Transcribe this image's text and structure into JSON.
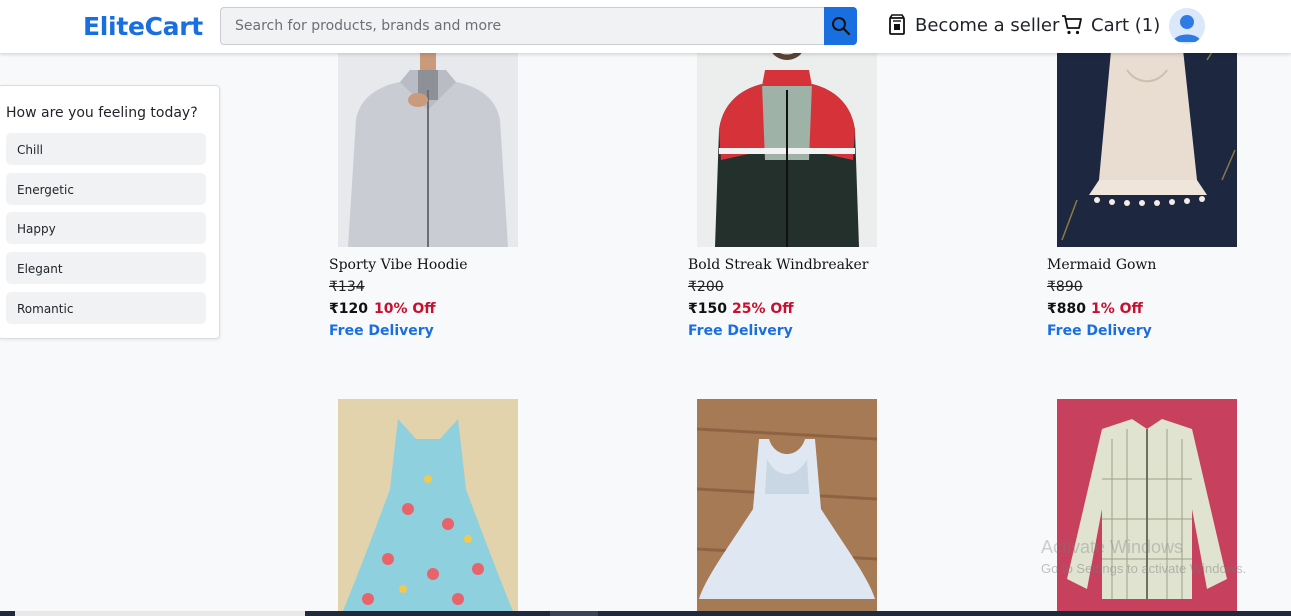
{
  "header": {
    "logo": "EliteCart",
    "search_placeholder": "Search for products, brands and more",
    "seller_label": "Become a seller",
    "cart_label": "Cart (1)",
    "icons": [
      "search-icon",
      "store-icon",
      "cart-icon",
      "user-avatar-icon"
    ],
    "accent": "#1a6fe0"
  },
  "mood": {
    "title": "How are you feeling today?",
    "options": [
      "Chill",
      "Energetic",
      "Happy",
      "Elegant",
      "Romantic"
    ]
  },
  "products": [
    {
      "name": "Sporty Vibe Hoodie",
      "mrp": "₹134",
      "price": "₹120",
      "off": "10% Off",
      "delivery": "Free Delivery"
    },
    {
      "name": "Bold Streak Windbreaker",
      "mrp": "₹200",
      "price": "₹150",
      "off": "25% Off",
      "delivery": "Free Delivery"
    },
    {
      "name": "Mermaid Gown",
      "mrp": "₹890",
      "price": "₹880",
      "off": "1% Off",
      "delivery": "Free Delivery"
    }
  ],
  "watermark": {
    "line1": "Activate Windows",
    "line2": "Go to Settings to activate Windows."
  },
  "colors": {
    "price_off": "#c8102e",
    "delivery": "#1a6fe0"
  }
}
